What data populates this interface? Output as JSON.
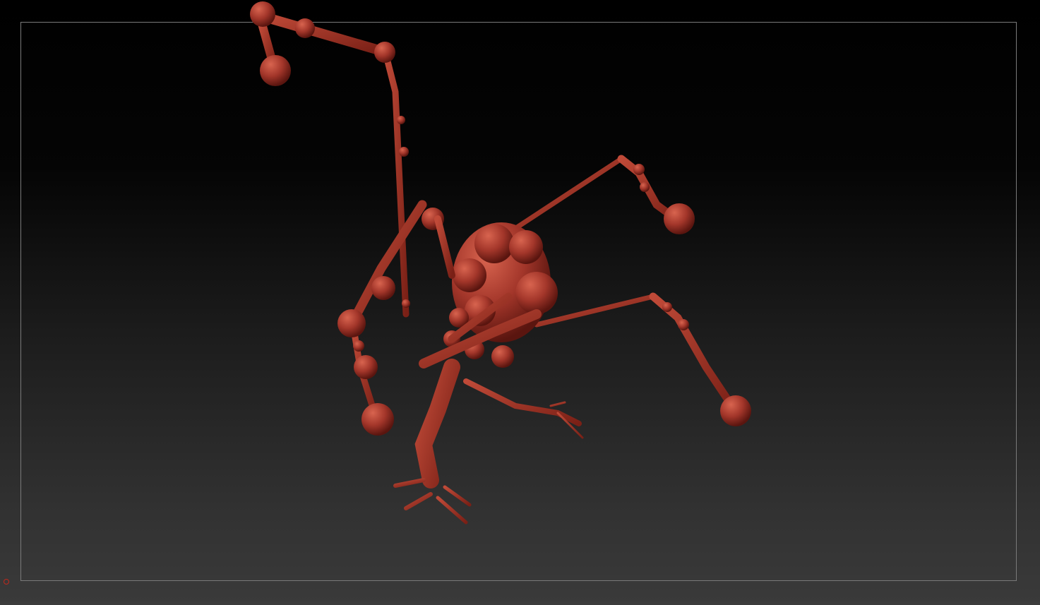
{
  "viewport": {
    "background_top": "#000000",
    "background_bottom": "#3a3a3a",
    "frame_color": "#7a7a7a"
  },
  "model": {
    "material_color": "#a3362a",
    "highlight_color": "#d2604c",
    "shadow_color": "#5a150f"
  },
  "marker": {
    "color": "#c0281c",
    "icon": "circle-marker-icon"
  }
}
